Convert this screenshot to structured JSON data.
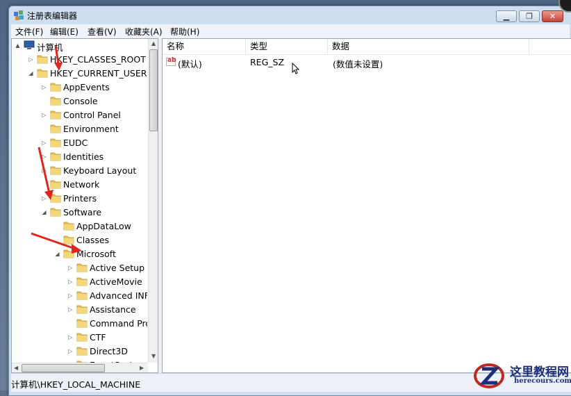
{
  "window": {
    "title": "注册表编辑器"
  },
  "menu": [
    "文件(F)",
    "编辑(E)",
    "查看(V)",
    "收藏夹(A)",
    "帮助(H)"
  ],
  "tree": [
    {
      "label": "计算机",
      "level": 0,
      "expander": "▲",
      "icon": "computer-icon"
    },
    {
      "label": "HKEY_CLASSES_ROOT",
      "level": 1,
      "expander": "▷"
    },
    {
      "label": "HKEY_CURRENT_USER",
      "level": 1,
      "expander": "◢"
    },
    {
      "label": "AppEvents",
      "level": 2,
      "expander": "▷"
    },
    {
      "label": "Console",
      "level": 2,
      "expander": ""
    },
    {
      "label": "Control Panel",
      "level": 2,
      "expander": "▷"
    },
    {
      "label": "Environment",
      "level": 2,
      "expander": ""
    },
    {
      "label": "EUDC",
      "level": 2,
      "expander": "▷"
    },
    {
      "label": "Identities",
      "level": 2,
      "expander": "▷"
    },
    {
      "label": "Keyboard Layout",
      "level": 2,
      "expander": "▷"
    },
    {
      "label": "Network",
      "level": 2,
      "expander": ""
    },
    {
      "label": "Printers",
      "level": 2,
      "expander": "▷"
    },
    {
      "label": "Software",
      "level": 2,
      "expander": "◢"
    },
    {
      "label": "AppDataLow",
      "level": 3,
      "expander": ""
    },
    {
      "label": "Classes",
      "level": 3,
      "expander": ""
    },
    {
      "label": "Microsoft",
      "level": 3,
      "expander": "◢"
    },
    {
      "label": "Active Setup",
      "level": 4,
      "expander": "▷"
    },
    {
      "label": "ActiveMovie",
      "level": 4,
      "expander": "▷"
    },
    {
      "label": "Advanced INF Se",
      "level": 4,
      "expander": "▷"
    },
    {
      "label": "Assistance",
      "level": 4,
      "expander": "▷"
    },
    {
      "label": "Command Proce",
      "level": 4,
      "expander": ""
    },
    {
      "label": "CTF",
      "level": 4,
      "expander": "▷"
    },
    {
      "label": "Direct3D",
      "level": 4,
      "expander": "▷"
    },
    {
      "label": "EventSystem",
      "level": 4,
      "expander": "▷"
    }
  ],
  "list": {
    "columns": [
      "名称",
      "类型",
      "数据"
    ],
    "rows": [
      {
        "name": "(默认)",
        "type": "REG_SZ",
        "data": "(数值未设置)"
      }
    ]
  },
  "status": "计算机\\HKEY_LOCAL_MACHINE",
  "watermark": {
    "title": "这里教程网",
    "url": "herecours.com"
  },
  "colors": {
    "folder": "#e8c25a",
    "arrow": "#e0261d",
    "window_frame": "#cfdeef"
  }
}
